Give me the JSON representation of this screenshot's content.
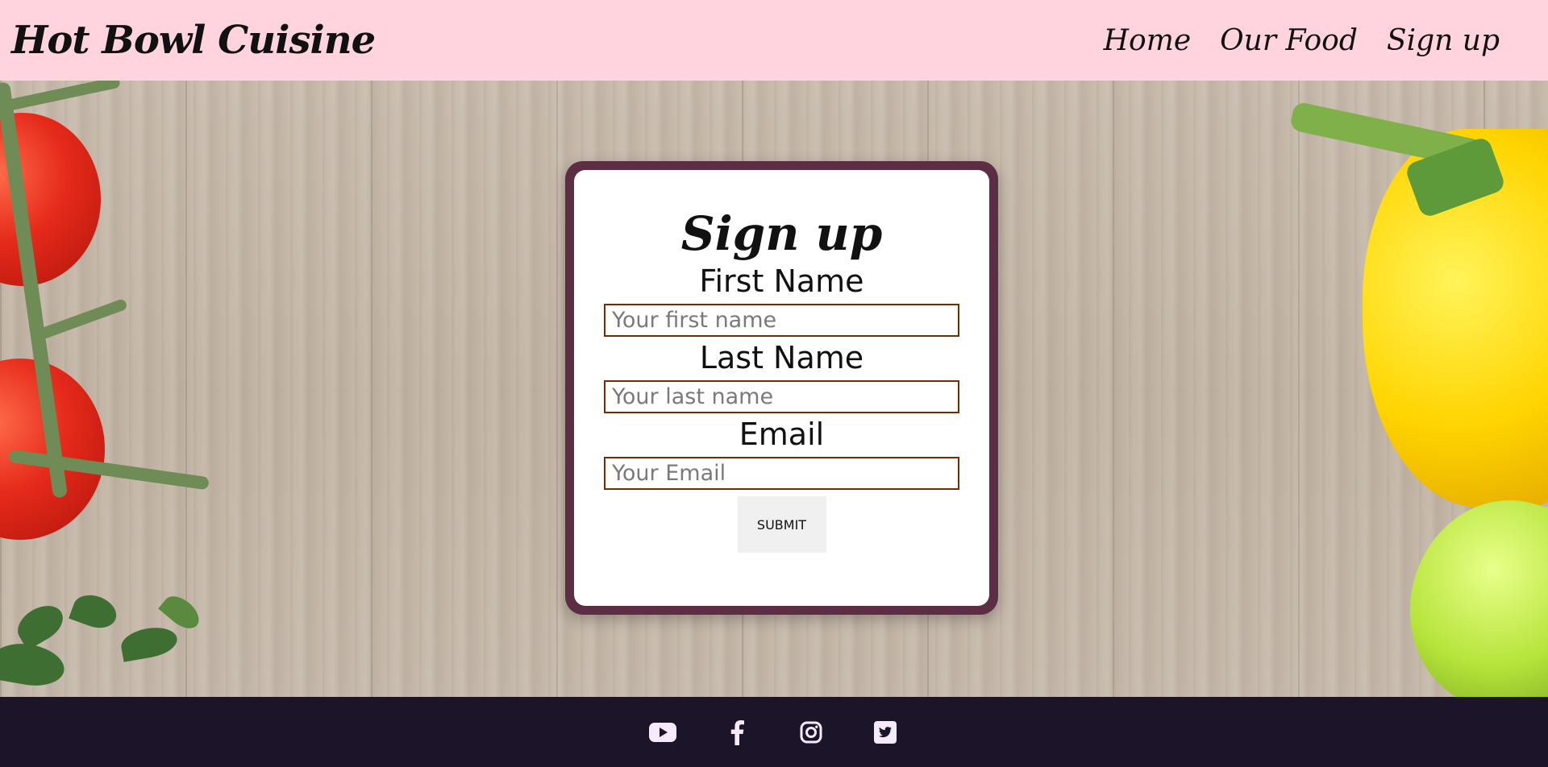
{
  "header": {
    "brand": "Hot Bowl Cuisine",
    "nav": [
      {
        "label": "Home"
      },
      {
        "label": "Our Food"
      },
      {
        "label": "Sign up"
      }
    ]
  },
  "form": {
    "title": "Sign up",
    "fields": [
      {
        "label": "First Name",
        "placeholder": "Your first name",
        "value": ""
      },
      {
        "label": "Last Name",
        "placeholder": "Your last name",
        "value": ""
      },
      {
        "label": "Email",
        "placeholder": "Your Email",
        "value": ""
      }
    ],
    "submit_label": "SUBMIT"
  },
  "footer": {
    "social": [
      {
        "icon": "youtube-icon"
      },
      {
        "icon": "facebook-icon"
      },
      {
        "icon": "instagram-icon"
      },
      {
        "icon": "twitter-icon"
      }
    ]
  },
  "colors": {
    "header_bg": "#ffd4df",
    "card_border": "#5c2e43",
    "input_border": "#7a2a00",
    "footer_bg": "#1c1529",
    "icon_color": "#f5eaff"
  }
}
